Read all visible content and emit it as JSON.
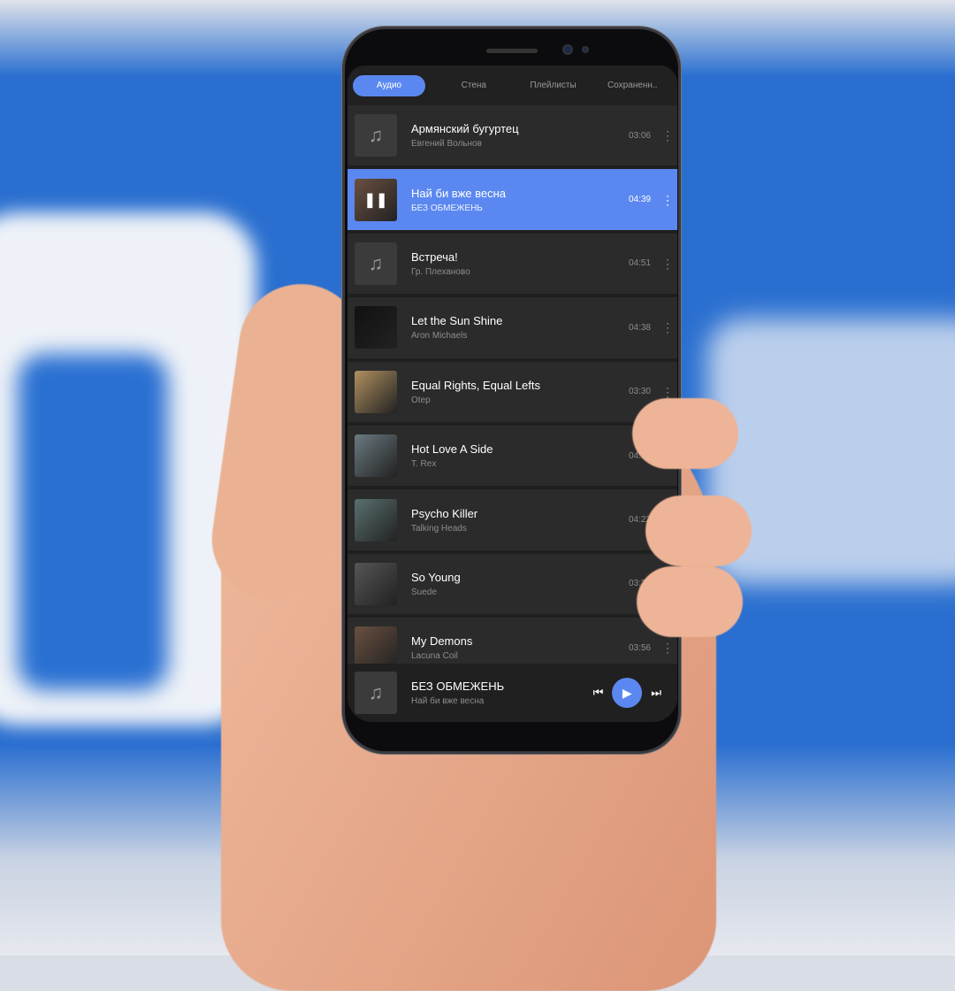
{
  "accent": "#5b88f0",
  "tabs": [
    {
      "label": "Аудио",
      "active": true
    },
    {
      "label": "Стена"
    },
    {
      "label": "Плейлисты"
    },
    {
      "label": "Сохраненн.."
    }
  ],
  "tracks": [
    {
      "title": "Армянский бугуртец",
      "artist": "Евгений Вольнов",
      "duration": "03:06",
      "cover": "music-note-icon"
    },
    {
      "title": "Най би вже весна",
      "artist": "БЕЗ ОБМЕЖЕНЬ",
      "duration": "04:39",
      "cover": "album-art",
      "playing": true
    },
    {
      "title": "Встреча!",
      "artist": "Гр. Плеханово",
      "duration": "04:51",
      "cover": "music-note-icon"
    },
    {
      "title": "Let the Sun Shine",
      "artist": "Aron Michaels",
      "duration": "04:38",
      "cover": "album-art"
    },
    {
      "title": "Equal Rights, Equal Lefts",
      "artist": "Otep",
      "duration": "03:30",
      "cover": "album-art"
    },
    {
      "title": "Hot Love A Side",
      "artist": "T. Rex",
      "duration": "04:55",
      "cover": "album-art"
    },
    {
      "title": "Psycho Killer",
      "artist": "Talking Heads",
      "duration": "04:22",
      "cover": "album-art"
    },
    {
      "title": "So Young",
      "artist": "Suede",
      "duration": "03:37",
      "cover": "album-art"
    },
    {
      "title": "My Demons",
      "artist": "Lacuna Coil",
      "duration": "03:56",
      "cover": "album-art"
    }
  ],
  "player": {
    "artist": "БЕЗ ОБМЕЖЕНЬ",
    "title": "Най би вже весна"
  }
}
